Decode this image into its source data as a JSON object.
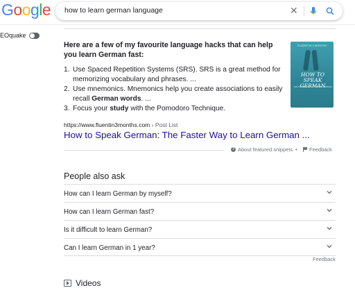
{
  "header": {
    "logo_letters": [
      {
        "ch": "G",
        "color": "#4285F4"
      },
      {
        "ch": "o",
        "color": "#EA4335"
      },
      {
        "ch": "o",
        "color": "#FBBC05"
      },
      {
        "ch": "g",
        "color": "#4285F4"
      },
      {
        "ch": "l",
        "color": "#34A853"
      },
      {
        "ch": "e",
        "color": "#EA4335"
      }
    ],
    "search_value": "how to learn german language",
    "clear_icon": "close-icon",
    "mic_icon": "microphone-icon",
    "search_icon": "magnifier-icon"
  },
  "seoquake": {
    "label": "EOquake"
  },
  "featured_snippet": {
    "intro": "Here are a few of my favourite language hacks that can help you learn German fast:",
    "items": [
      {
        "num": "1.",
        "pre": "Use Spaced Repetition Systems (SRS). SRS is a great method for memorizing vocabulary and phrases. ...",
        "bold": "",
        "post": ""
      },
      {
        "num": "2.",
        "pre": "Use mnemonics. Mnemonics help you create associations to easily recall ",
        "bold": "German words",
        "post": ". ..."
      },
      {
        "num": "3.",
        "pre": "Focus your ",
        "bold": "study",
        "post": " with the Pomodoro Technique."
      }
    ],
    "thumbnail": {
      "top_text": "FLUENT IN 3 MONTHS",
      "title": "HOW TO SPEAK GERMAN",
      "subtitle": "THE FASTER WAY TO LEARN GERMAN"
    },
    "source_url": "https://www.fluentin3months.com",
    "source_crumb": " › Post List",
    "result_title": "How to Speak German: The Faster Way to Learn German ...",
    "about_label": "About featured snippets",
    "dot": "•",
    "feedback_label": "Feedback"
  },
  "people_also_ask": {
    "title": "People also ask",
    "questions": [
      "How can I learn German by myself?",
      "How can I learn German fast?",
      "Is it difficult to learn German?",
      "Can I learn German in 1 year?"
    ],
    "feedback_label": "Feedback"
  },
  "videos": {
    "label": "Videos"
  }
}
